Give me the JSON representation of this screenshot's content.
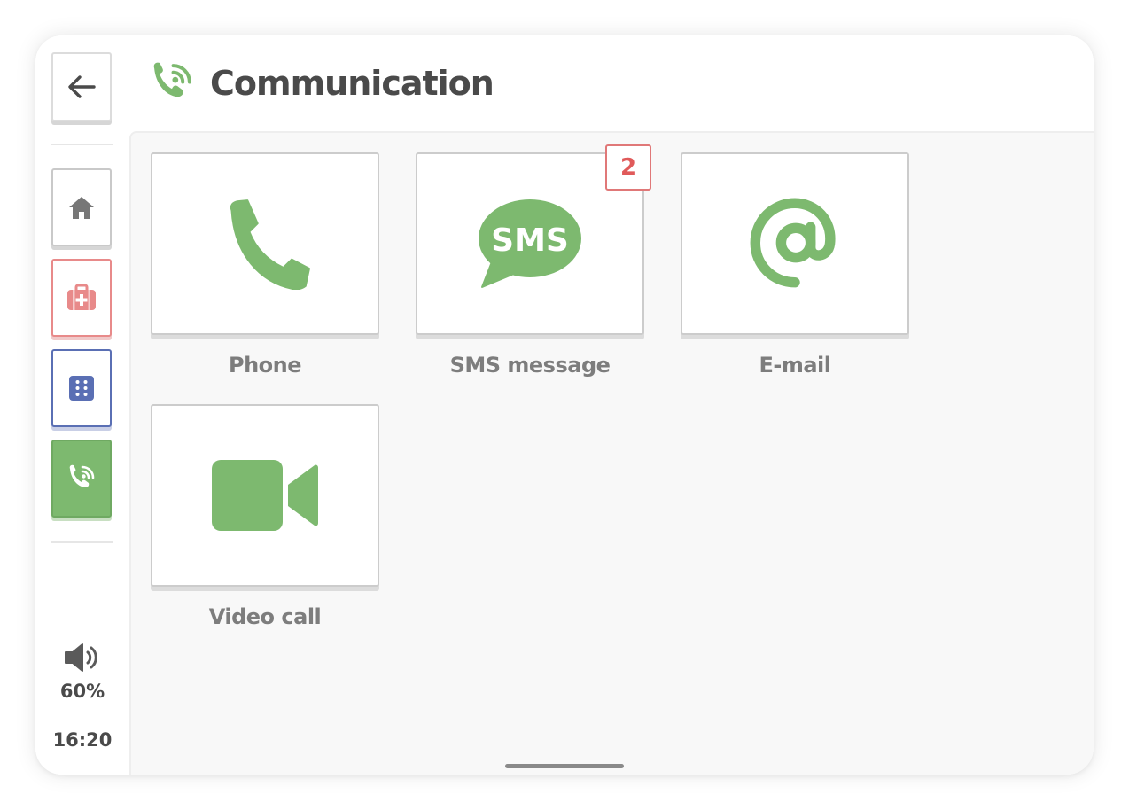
{
  "colors": {
    "accent_green": "#7db96f",
    "health_red": "#e88a8a",
    "apps_blue": "#5a6fb4",
    "badge_red": "#e05a5a",
    "title_text": "#4a4a4a",
    "label_text": "#7d7d7d"
  },
  "header": {
    "title": "Communication",
    "icon": "phone-signal-icon"
  },
  "sidebar": {
    "back": {
      "icon": "arrow-left-icon"
    },
    "items": [
      {
        "key": "home",
        "icon": "home-icon"
      },
      {
        "key": "health",
        "icon": "medical-kit-icon"
      },
      {
        "key": "apps",
        "icon": "apps-grid-icon"
      },
      {
        "key": "communication",
        "icon": "phone-signal-icon",
        "active": true
      }
    ],
    "volume": {
      "icon": "speaker-icon",
      "value": "60%"
    },
    "clock": "16:20"
  },
  "tiles": [
    {
      "label": "Phone",
      "icon": "phone-icon"
    },
    {
      "label": "SMS message",
      "icon": "sms-bubble-icon",
      "icon_text": "SMS",
      "badge": "2"
    },
    {
      "label": "E-mail",
      "icon": "at-sign-icon"
    },
    {
      "label": "Video call",
      "icon": "video-camera-icon"
    }
  ]
}
